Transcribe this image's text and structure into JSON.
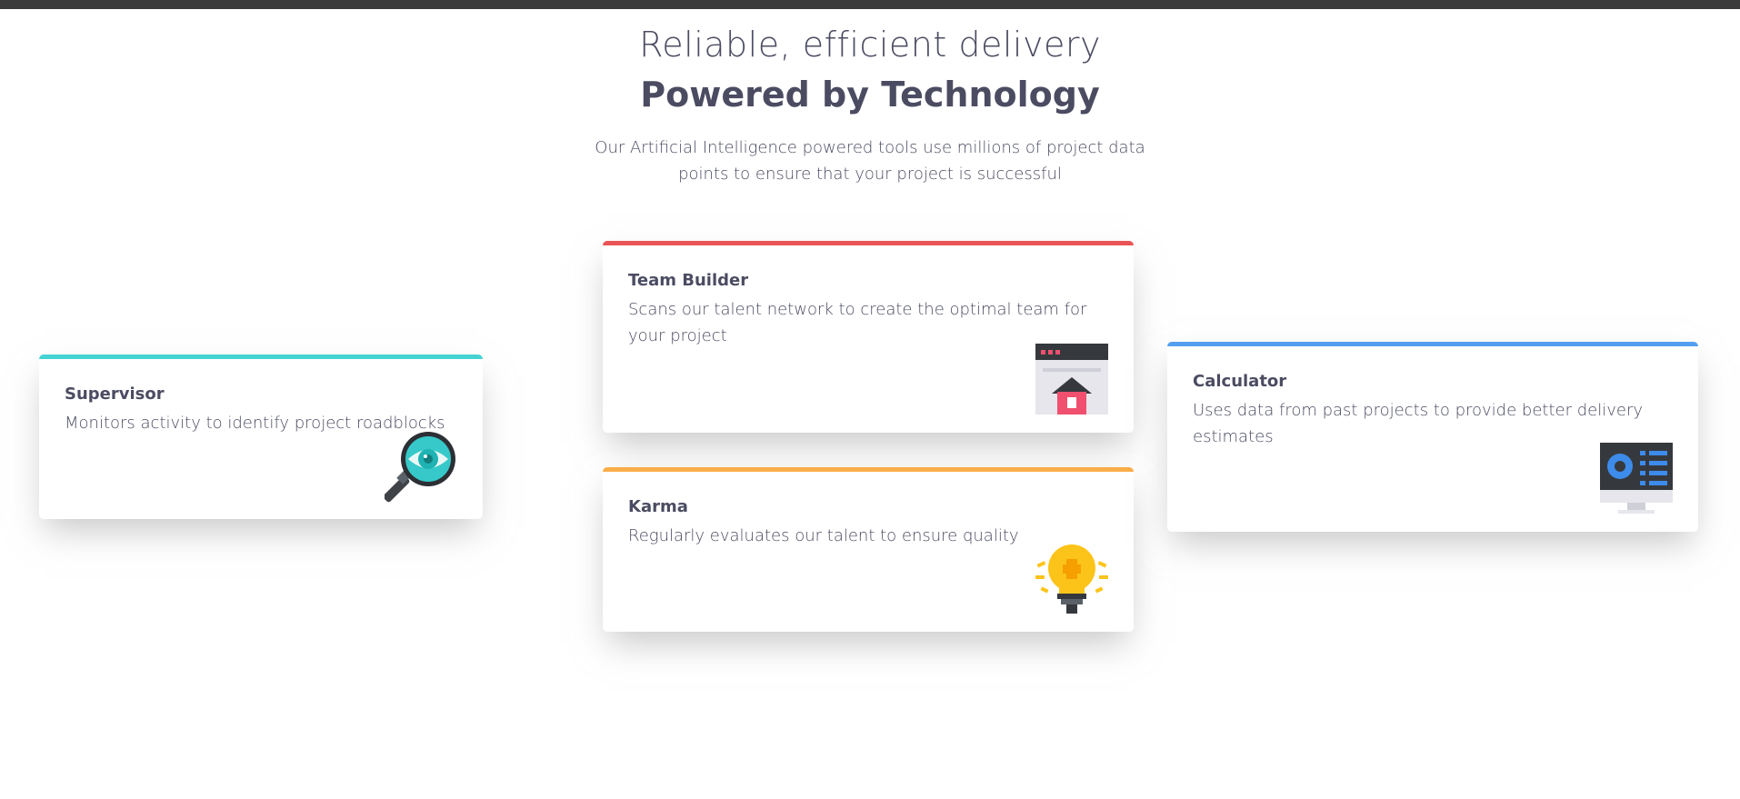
{
  "header": {
    "subtitle": "Reliable, efficient delivery",
    "title": "Powered by Technology",
    "intro": "Our Artificial Intelligence powered tools use millions of project data points to ensure that your project is successful"
  },
  "cards": {
    "supervisor": {
      "title": "Supervisor",
      "description": "Monitors activity to identify project roadblocks",
      "accent": "#44d3d2",
      "icon": "magnifier-eye-icon"
    },
    "team_builder": {
      "title": "Team Builder",
      "description": "Scans our talent network to create the optimal team for your project",
      "accent": "#ea5454",
      "icon": "browser-house-icon"
    },
    "karma": {
      "title": "Karma",
      "description": "Regularly evaluates our talent to ensure quality",
      "accent": "#fcae4a",
      "icon": "lightbulb-icon"
    },
    "calculator": {
      "title": "Calculator",
      "description": "Uses data from past projects to provide better delivery estimates",
      "accent": "#549ef2",
      "icon": "monitor-chart-icon"
    }
  }
}
